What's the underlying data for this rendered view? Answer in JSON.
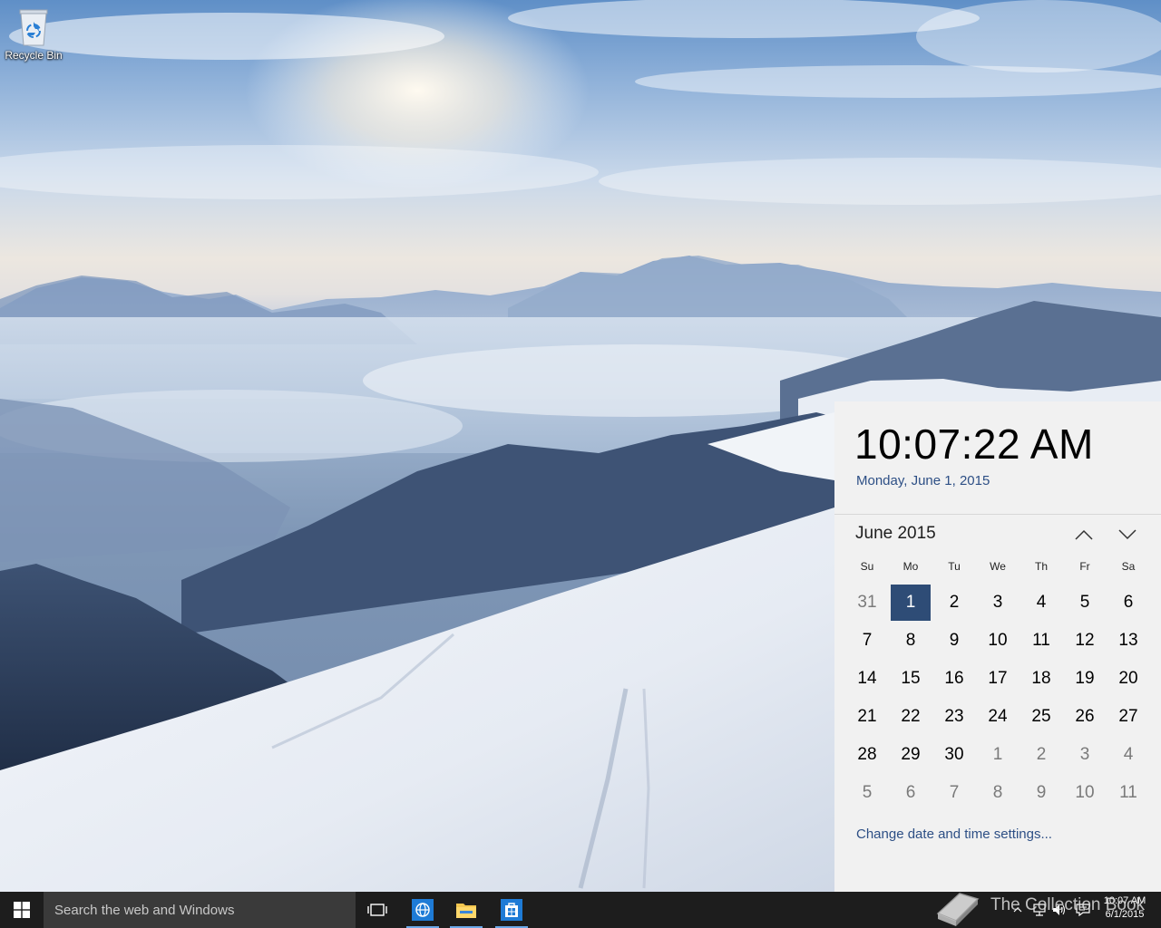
{
  "desktop": {
    "icons": [
      {
        "label": "Recycle Bin",
        "icon": "recycle-bin-icon"
      }
    ]
  },
  "clock_flyout": {
    "time": "10:07:22 AM",
    "date": "Monday, June 1, 2015",
    "month_label": "June 2015",
    "nav": {
      "previous_icon": "chevron-up-icon",
      "next_icon": "chevron-down-icon"
    },
    "weekdays": [
      "Su",
      "Mo",
      "Tu",
      "We",
      "Th",
      "Fr",
      "Sa"
    ],
    "days": [
      [
        "31",
        "1",
        "2",
        "3",
        "4",
        "5",
        "6"
      ],
      [
        "7",
        "8",
        "9",
        "10",
        "11",
        "12",
        "13"
      ],
      [
        "14",
        "15",
        "16",
        "17",
        "18",
        "19",
        "20"
      ],
      [
        "21",
        "22",
        "23",
        "24",
        "25",
        "26",
        "27"
      ],
      [
        "28",
        "29",
        "30",
        "1",
        "2",
        "3",
        "4"
      ],
      [
        "5",
        "6",
        "7",
        "8",
        "9",
        "10",
        "11"
      ]
    ],
    "selected_day": "1",
    "settings_link": "Change date and time settings..."
  },
  "taskbar": {
    "start_icon": "windows-logo-icon",
    "search_placeholder": "Search the web and Windows",
    "pinned": [
      {
        "name": "task-view",
        "icon": "task-view-icon"
      },
      {
        "name": "internet-explorer",
        "icon": "internet-explorer-icon"
      },
      {
        "name": "file-explorer",
        "icon": "folder-icon"
      },
      {
        "name": "store",
        "icon": "store-icon"
      }
    ],
    "tray": {
      "icons": [
        "chevron-up-icon",
        "network-icon",
        "volume-icon",
        "action-center-icon"
      ],
      "time": "10:07 AM",
      "date": "6/1/2015"
    }
  },
  "watermark": {
    "text": "The Collection Book"
  },
  "colors": {
    "accent": "#2e4c76",
    "link": "#2d4f85",
    "flyout_bg": "#f1f1f1",
    "taskbar_bg": "#1d1d1d"
  }
}
